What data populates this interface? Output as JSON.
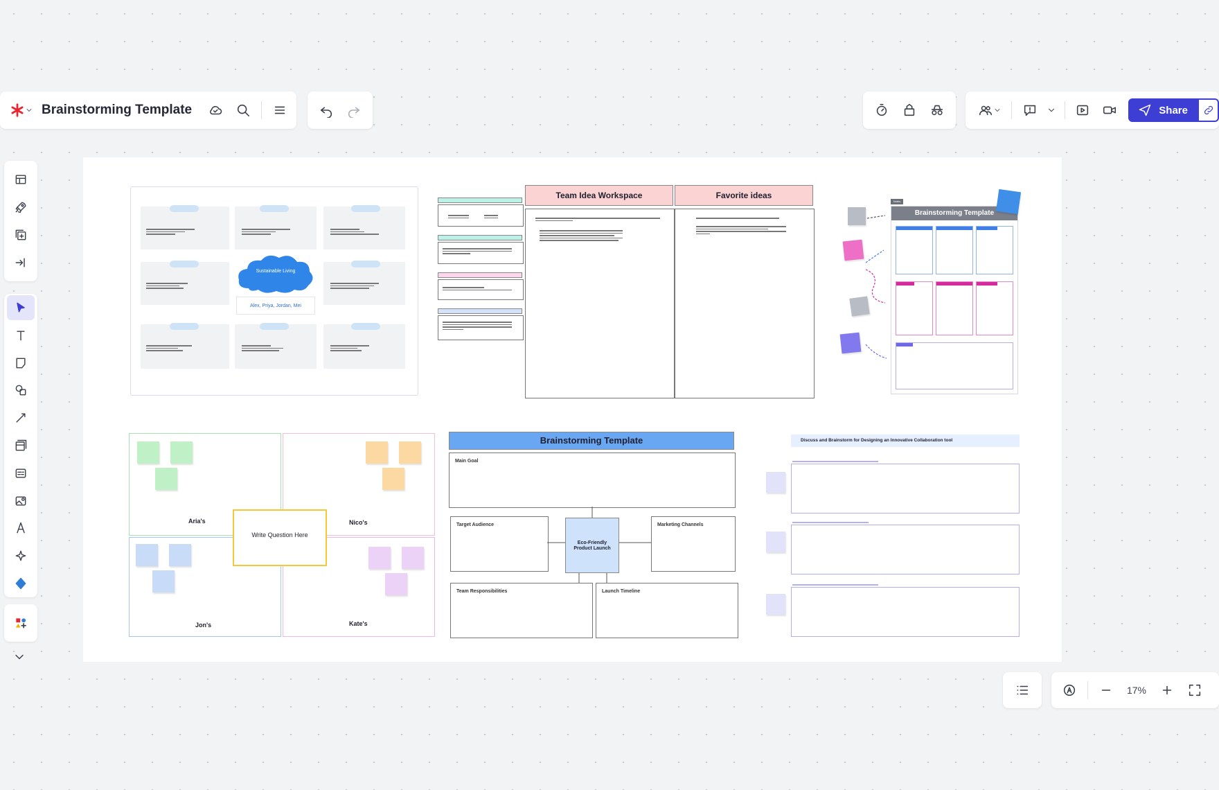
{
  "toolbar": {
    "title": "Brainstorming Template",
    "share_label": "Share"
  },
  "zoom": {
    "level": "17%"
  },
  "colors": {
    "accent": "#3d3ed4",
    "logo": "#e8262f"
  },
  "canvas": {
    "frame1": {
      "cloud_label": "Sustainable Living",
      "names": "Alex, Priya, Jordan, Mei"
    },
    "frame2": {
      "team_idea_workspace": "Team Idea Workspace",
      "favorite_ideas": "Favorite ideas"
    },
    "frame3": {
      "header": "Brainstorming Template",
      "tag": "Notes"
    },
    "frame4": {
      "arias": "Aria's",
      "nicos": "Nico's",
      "jons": "Jon's",
      "kates": "Kate's",
      "question": "Write Question Here"
    },
    "frame5": {
      "header": "Brainstorming Template",
      "main_goal": "Main Goal",
      "target_audience": "Target Audience",
      "center": "Eco-Friendly Product Launch",
      "marketing_channels": "Marketing Channels",
      "team_responsibilities": "Team Responsibilities",
      "launch_timeline": "Launch Timeline"
    },
    "frame6": {
      "header": "Discuss and Brainstorm for Designing an Innovative Collaboration tool"
    }
  }
}
